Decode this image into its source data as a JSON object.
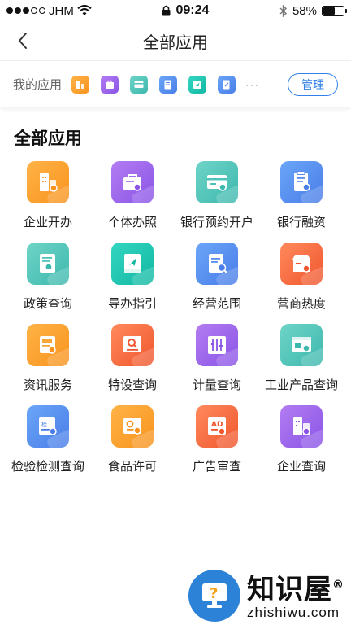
{
  "status_bar": {
    "carrier": "JHM",
    "time": "09:24",
    "battery": "58%",
    "battery_level": 0.58
  },
  "nav": {
    "title": "全部应用",
    "back_icon": "chevron-left-icon"
  },
  "my_apps": {
    "label": "我的应用",
    "more": "···",
    "manage_label": "管理",
    "icons": [
      {
        "name": "enterprise-icon",
        "color": "#f7a73a"
      },
      {
        "name": "individual-license-icon",
        "color": "#9b66ea"
      },
      {
        "name": "bank-card-icon",
        "color": "#4fc3b9"
      },
      {
        "name": "document-search-icon",
        "color": "#5a8cf0"
      },
      {
        "name": "guide-icon",
        "color": "#17c0ab"
      },
      {
        "name": "form-icon",
        "color": "#5a8cf0"
      }
    ]
  },
  "section": {
    "title": "全部应用"
  },
  "apps": [
    {
      "label": "企业开办",
      "icon": "enterprise-icon"
    },
    {
      "label": "个体办照",
      "icon": "individual-license-icon"
    },
    {
      "label": "银行预约开户",
      "icon": "bank-account-icon"
    },
    {
      "label": "银行融资",
      "icon": "bank-finance-icon"
    },
    {
      "label": "政策查询",
      "icon": "policy-certificate-icon"
    },
    {
      "label": "导办指引",
      "icon": "guide-book-icon"
    },
    {
      "label": "经营范围",
      "icon": "business-scope-icon"
    },
    {
      "label": "营商热度",
      "icon": "shop-heat-icon"
    },
    {
      "label": "资讯服务",
      "icon": "news-service-icon"
    },
    {
      "label": "特设查询",
      "icon": "equipment-search-icon"
    },
    {
      "label": "计量查询",
      "icon": "measurement-icon"
    },
    {
      "label": "工业产品查询",
      "icon": "industrial-product-icon"
    },
    {
      "label": "检验检测查询",
      "icon": "inspection-icon"
    },
    {
      "label": "食品许可",
      "icon": "food-license-icon"
    },
    {
      "label": "广告审查",
      "icon": "ad-review-icon"
    },
    {
      "label": "企业查询",
      "icon": "enterprise-search-icon"
    }
  ],
  "watermark": {
    "cn": "知识屋",
    "en": "zhishiwu.com",
    "mark": "®"
  }
}
